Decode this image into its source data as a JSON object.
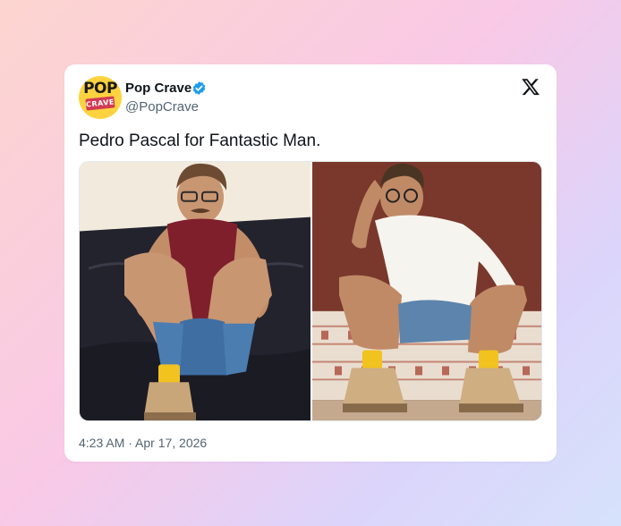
{
  "tweet": {
    "author": {
      "display_name": "Pop Crave",
      "handle": "@PopCrave",
      "verified": true,
      "avatar_text_top": "POP",
      "avatar_text_bottom": "CRAVE",
      "avatar_icon": "pop-crave-logo"
    },
    "platform_icon": "x-logo-icon",
    "text": "Pedro Pascal for Fantastic Man.",
    "media": [
      {
        "kind": "photo",
        "subject": "man in maroon sleeveless top and denim shorts on dark leather sofa"
      },
      {
        "kind": "photo",
        "subject": "man in white shirt and denim shorts on patterned bench"
      }
    ],
    "timestamp": "4:23 AM · Apr 17, 2026"
  },
  "colors": {
    "verified_badge": "#1d9bf0",
    "text_primary": "#0f1419",
    "text_secondary": "#536471",
    "avatar_bg": "#ffd23f",
    "avatar_accent": "#d23a52"
  }
}
